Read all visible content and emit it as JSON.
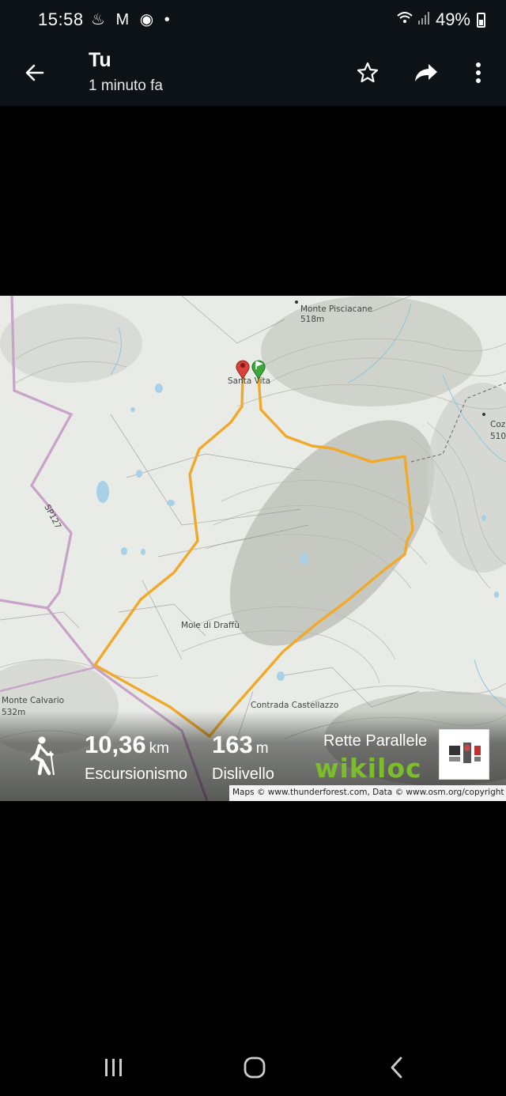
{
  "status_bar": {
    "time": "15:58",
    "notification_icons": "♨ M ◉ •",
    "battery_percent": "49%"
  },
  "app_bar": {
    "title": "Tu",
    "subtitle": "1 minuto fa",
    "icons": [
      "back-arrow-icon",
      "star-icon",
      "share-icon",
      "more-vert-icon"
    ]
  },
  "map": {
    "labels": {
      "monte_pisciacane": "Monte Pisciacane",
      "monte_pisciacane_alt": "518m",
      "santa_vita": "Santa Vita",
      "coz": "Coz",
      "coz_alt": "510",
      "sp127": "SP127",
      "mole_di_draffu": "Mole di Draffù",
      "monte_calvario": "Monte Calvario",
      "monte_calvario_alt": "532m",
      "contrada_castellazzo": "Contrada Castellazzo"
    },
    "colors": {
      "track": "#f0a92a",
      "road": "#c8a2c8",
      "start_flag": "#3aa83a",
      "end_pin": "#d9413a"
    }
  },
  "stats": {
    "distance_value": "10,36",
    "distance_unit": "km",
    "activity": "Escursionismo",
    "elevation_value": "163",
    "elevation_unit": "m",
    "elevation_label": "Dislivello"
  },
  "branding": {
    "name": "Rette Parallele",
    "wikiloc": "wikiloc",
    "credit": "Maps © www.thunderforest.com, Data © www.osm.org/copyright"
  },
  "nav_bar": {
    "icons": [
      "recent-apps-icon",
      "home-icon",
      "back-icon"
    ]
  }
}
